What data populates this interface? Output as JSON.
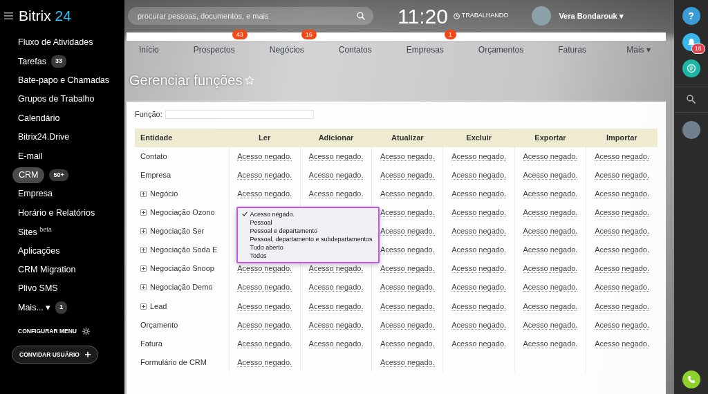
{
  "sidebar": {
    "logo": {
      "text": "Bitrix",
      "accent": "24"
    },
    "items": [
      {
        "label": "Fluxo de Atividades",
        "selected": false
      },
      {
        "label": "Tarefas",
        "badge": "33",
        "selected": false
      },
      {
        "label": "Bate-papo e Chamadas",
        "selected": false
      },
      {
        "label": "Grupos de Trabalho",
        "selected": false
      },
      {
        "label": "Calendário",
        "selected": false
      },
      {
        "label": "Bitrix24.Drive",
        "selected": false
      },
      {
        "label": "E-mail",
        "selected": false
      },
      {
        "label": "CRM",
        "badge": "50+",
        "selected": true
      },
      {
        "label": "Empresa",
        "selected": false
      },
      {
        "label": "Horário e Relatórios",
        "selected": false
      },
      {
        "label": "Sites",
        "sup": "beta",
        "selected": false
      },
      {
        "label": "Aplicações",
        "selected": false
      },
      {
        "label": "CRM Migration",
        "selected": false
      },
      {
        "label": "Plivo SMS",
        "selected": false
      },
      {
        "label": "Mais...",
        "caret": "▾",
        "badge": "1",
        "selected": false
      }
    ],
    "configure_menu": "CONFIGURAR MENU",
    "invite_button": "CONVIDAR USUÁRIO"
  },
  "header": {
    "search": {
      "placeholder": "procurar pessoas, documentos, e mais"
    },
    "time": "11:20",
    "status": "TRABALHANDO",
    "user": "Vera Bondarouk",
    "user_caret": "▾"
  },
  "tabs": [
    {
      "label": "Início"
    },
    {
      "label": "Prospectos",
      "counter": "43"
    },
    {
      "label": "Negócios",
      "counter": "16"
    },
    {
      "label": "Contatos"
    },
    {
      "label": "Empresas",
      "counter": "1"
    },
    {
      "label": "Orçamentos"
    },
    {
      "label": "Faturas"
    },
    {
      "label": "Mais",
      "caret": "▾"
    }
  ],
  "page_title": "Gerenciar funções",
  "role_field": {
    "label": "Função:"
  },
  "table": {
    "columns": [
      "Entidade",
      "Ler",
      "Adicionar",
      "Atualizar",
      "Excluir",
      "Exportar",
      "Importar"
    ],
    "rows": [
      {
        "expandable": false,
        "cells": [
          "Contato",
          "Acesso negado.",
          "Acesso negado.",
          "Acesso negado.",
          "Acesso negado.",
          "Acesso negado.",
          "Acesso negado."
        ]
      },
      {
        "expandable": false,
        "cells": [
          "Empresa",
          "Acesso negado.",
          "Acesso negado.",
          "Acesso negado.",
          "Acesso negado.",
          "Acesso negado.",
          "Acesso negado."
        ]
      },
      {
        "expandable": true,
        "cells": [
          "Negócio",
          "Acesso negado.",
          "Acesso negado.",
          "Acesso negado.",
          "Acesso negado.",
          "Acesso negado.",
          "Acesso negado."
        ]
      },
      {
        "expandable": true,
        "cells": [
          "Negociação Ozono",
          "",
          "",
          "Acesso negado.",
          "Acesso negado.",
          "Acesso negado.",
          "Acesso negado."
        ],
        "dropdown": {
          "options": [
            {
              "label": "Acesso negado.",
              "selected": true
            },
            {
              "label": "Pessoal",
              "selected": false
            },
            {
              "label": "Pessoal e departamento",
              "selected": false
            },
            {
              "label": "Pessoal, departamento e subdepartamentos",
              "selected": false
            },
            {
              "label": "Tudo aberto",
              "selected": false
            },
            {
              "label": "Todos",
              "selected": false
            }
          ]
        }
      },
      {
        "expandable": true,
        "cells": [
          "Negociação Ser",
          "",
          "",
          "Acesso negado.",
          "Acesso negado.",
          "Acesso negado.",
          "Acesso negado."
        ]
      },
      {
        "expandable": true,
        "cells": [
          "Negociação Soda E",
          "",
          "",
          "Acesso negado.",
          "Acesso negado.",
          "Acesso negado.",
          "Acesso negado."
        ]
      },
      {
        "expandable": true,
        "cells": [
          "Negociação Snoop",
          "Acesso negado.",
          "Acesso negado.",
          "Acesso negado.",
          "Acesso negado.",
          "Acesso negado.",
          "Acesso negado."
        ]
      },
      {
        "expandable": true,
        "cells": [
          "Negociação Demo",
          "Acesso negado.",
          "Acesso negado.",
          "Acesso negado.",
          "Acesso negado.",
          "Acesso negado.",
          "Acesso negado."
        ]
      },
      {
        "expandable": true,
        "cells": [
          "Lead",
          "Acesso negado.",
          "Acesso negado.",
          "Acesso negado.",
          "Acesso negado.",
          "Acesso negado.",
          "Acesso negado."
        ]
      },
      {
        "expandable": false,
        "cells": [
          "Orçamento",
          "Acesso negado.",
          "Acesso negado.",
          "Acesso negado.",
          "Acesso negado.",
          "Acesso negado.",
          "Acesso negado."
        ]
      },
      {
        "expandable": false,
        "cells": [
          "Fatura",
          "Acesso negado.",
          "Acesso negado.",
          "Acesso negado.",
          "Acesso negado.",
          "Acesso negado.",
          "Acesso negado."
        ]
      },
      {
        "expandable": false,
        "cells": [
          "Formulário de CRM",
          "Acesso negado.",
          "",
          "Acesso negado.",
          "",
          "",
          ""
        ]
      }
    ]
  },
  "right_panel": {
    "help": "?",
    "notification_count": "16"
  }
}
